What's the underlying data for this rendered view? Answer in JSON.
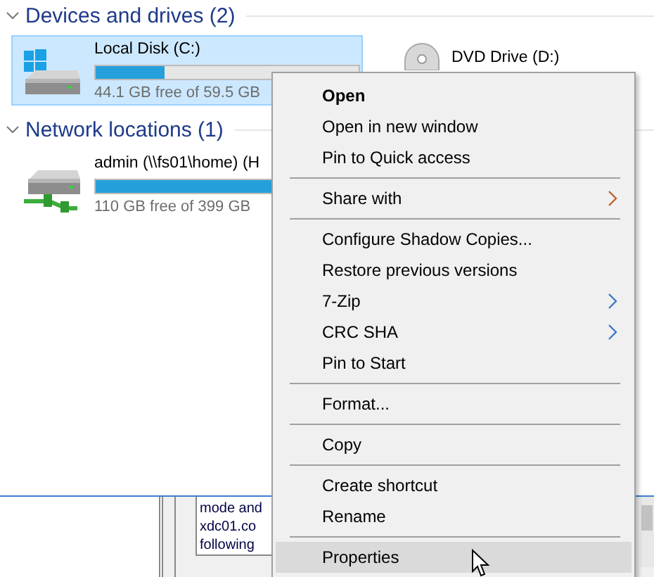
{
  "groups": [
    {
      "title": "Devices and drives (2)",
      "expanded": true,
      "drives": [
        {
          "kind": "system",
          "name": "Local Disk (C:)",
          "level": 0.26,
          "free": "44.1 GB free of 59.5 GB",
          "selected": true
        },
        {
          "kind": "optical",
          "name": "DVD Drive (D:)",
          "selected": false
        }
      ]
    },
    {
      "title": "Network locations (1)",
      "expanded": true,
      "drives": [
        {
          "kind": "network",
          "name": "admin (\\\\fs01\\home) (H",
          "level": 0.72,
          "free": "110 GB free of 399 GB",
          "selected": false
        }
      ]
    }
  ],
  "dialog": {
    "text_lines": [
      "mode and",
      "xdc01.co",
      "following"
    ]
  },
  "context_menu": {
    "items": [
      {
        "kind": "item",
        "label": "Open",
        "default": true,
        "selected": false
      },
      {
        "kind": "item",
        "label": "Open in new window",
        "default": false,
        "selected": false
      },
      {
        "kind": "item",
        "label": "Pin to Quick access",
        "default": false,
        "selected": false
      },
      {
        "kind": "separator"
      },
      {
        "kind": "submenu",
        "label": "Share with",
        "default": false,
        "selected": false,
        "color": "#c0602a"
      },
      {
        "kind": "separator"
      },
      {
        "kind": "item",
        "label": "Configure Shadow Copies...",
        "default": false,
        "selected": false
      },
      {
        "kind": "item",
        "label": "Restore previous versions",
        "default": false,
        "selected": false
      },
      {
        "kind": "submenu",
        "label": "7-Zip",
        "default": false,
        "selected": false,
        "color": "#3a78c8"
      },
      {
        "kind": "submenu",
        "label": "CRC SHA",
        "default": false,
        "selected": false,
        "color": "#3a78c8"
      },
      {
        "kind": "item",
        "label": "Pin to Start",
        "default": false,
        "selected": false
      },
      {
        "kind": "separator"
      },
      {
        "kind": "item",
        "label": "Format...",
        "default": false,
        "selected": false
      },
      {
        "kind": "separator"
      },
      {
        "kind": "item",
        "label": "Copy",
        "default": false,
        "selected": false
      },
      {
        "kind": "separator"
      },
      {
        "kind": "item",
        "label": "Create shortcut",
        "default": false,
        "selected": false
      },
      {
        "kind": "item",
        "label": "Rename",
        "default": false,
        "selected": false
      },
      {
        "kind": "separator"
      },
      {
        "kind": "item",
        "label": "Properties",
        "default": false,
        "selected": true
      }
    ]
  }
}
